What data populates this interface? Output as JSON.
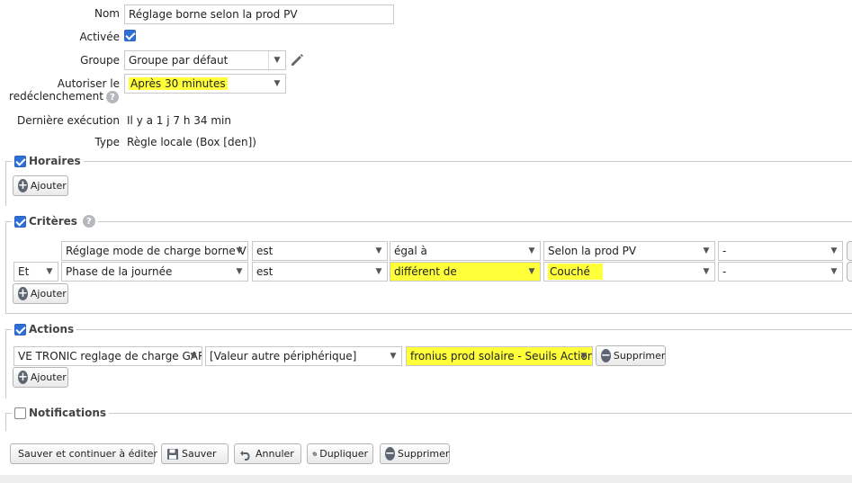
{
  "form": {
    "name_label": "Nom",
    "name_value": "Réglage borne selon la prod PV",
    "active_label": "Activée",
    "group_label": "Groupe",
    "group_value": "Groupe par défaut",
    "retrigger_label_1": "Autoriser le",
    "retrigger_label_2": "redéclenchement",
    "retrigger_value": "Après 30 minutes",
    "last_exec_label": "Dernière exécution",
    "last_exec_value": "Il y a 1 j 7 h 34 min",
    "type_label": "Type",
    "type_value": "Règle locale (Box [den])"
  },
  "sections": {
    "schedules": {
      "title": "Horaires",
      "checked": true,
      "add_label": "Ajouter"
    },
    "criteria": {
      "title": "Critères",
      "checked": true,
      "add_label": "Ajouter",
      "rows": [
        {
          "connector": "",
          "subject": "Réglage mode de charge borne VE",
          "verb": "est",
          "operator": "égal à",
          "value": "Selon la prod PV",
          "extra": "-"
        },
        {
          "connector": "Et",
          "subject": "Phase de la journée",
          "verb": "est",
          "operator": "différent de",
          "value": "Couché",
          "extra": "-"
        }
      ]
    },
    "actions": {
      "title": "Actions",
      "checked": true,
      "add_label": "Ajouter",
      "row": {
        "device": "VE TRONIC reglage de charge GAR",
        "mode": "[Valeur autre périphérique]",
        "source": "fronius prod solaire - Seuils Actionr",
        "delete_label": "Supprimer"
      }
    },
    "notifications": {
      "title": "Notifications",
      "checked": false
    }
  },
  "toolbar": {
    "save_continue_label": "Sauver et continuer à éditer",
    "save_label": "Sauver",
    "cancel_label": "Annuler",
    "duplicate_label": "Dupliquer",
    "delete_label": "Supprimer"
  },
  "colors": {
    "highlight": "#ffff3a",
    "checkbox": "#2e6fd8",
    "border": "#c9c9c9"
  }
}
